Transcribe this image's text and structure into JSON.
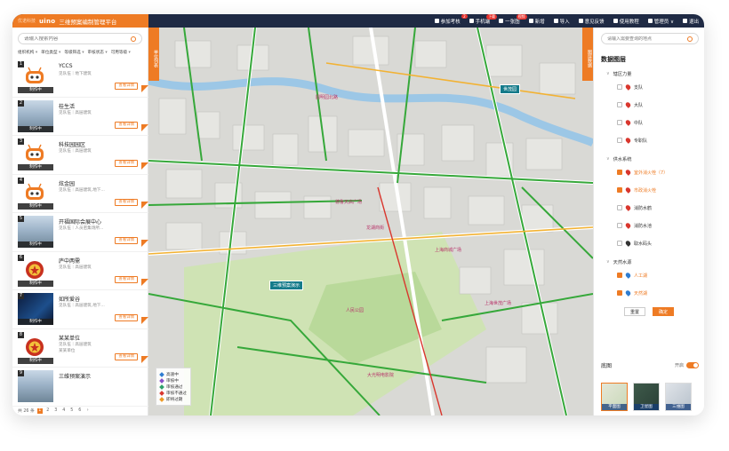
{
  "header": {
    "logo": "uino",
    "logo_sub": "优诺科技",
    "title": "三维预案编制管理平台",
    "menu": [
      {
        "label": "参加考核",
        "badge": "2",
        "icon": "document-icon"
      },
      {
        "label": "手机端",
        "badge": "下载",
        "icon": "phone-icon"
      },
      {
        "label": "一张图",
        "badge": "视频",
        "icon": "globe-icon"
      },
      {
        "label": "新增",
        "badge": "",
        "icon": "pencil-icon"
      },
      {
        "label": "导入",
        "badge": "",
        "icon": "arrow-up-icon"
      },
      {
        "label": "意见反馈",
        "badge": "",
        "icon": "info-icon"
      },
      {
        "label": "使用教程",
        "badge": "",
        "icon": "help-icon"
      },
      {
        "label": "管理员 ∨",
        "badge": "",
        "icon": "user-icon"
      },
      {
        "label": "退出",
        "badge": "",
        "icon": "logout-icon"
      }
    ]
  },
  "sidebar": {
    "search_placeholder": "请输入搜索内容",
    "filters": [
      "组织机构",
      "单位类型",
      "等级筛选",
      "审核状态",
      "可用等级"
    ],
    "collapse_label": "单位列表",
    "items": [
      {
        "num": "1",
        "name": "YCCS",
        "meta": "见队伍｜地下建筑",
        "sub": "",
        "status": "制作中",
        "button": "查看详情",
        "thumb": "robot"
      },
      {
        "num": "2",
        "name": "桂生活",
        "meta": "见队伍｜高层建筑",
        "sub": "",
        "status": "制作中",
        "button": "查看详情",
        "thumb": "photo"
      },
      {
        "num": "3",
        "name": "科技园园区",
        "meta": "见队伍｜高层建筑",
        "sub": "",
        "status": "制作中",
        "button": "查看详情",
        "thumb": "robot"
      },
      {
        "num": "4",
        "name": "炫金园",
        "meta": "见队伍｜高层建筑,地下...",
        "sub": "",
        "status": "制作中",
        "button": "查看详情",
        "thumb": "robot"
      },
      {
        "num": "5",
        "name": "开福国际会展中心",
        "meta": "见队伍｜人员密集场所...",
        "sub": "",
        "status": "制作中",
        "button": "查看详情",
        "thumb": "photo"
      },
      {
        "num": "6",
        "name": "庐中两需",
        "meta": "见队伍｜高层建筑",
        "sub": "",
        "status": "制作中",
        "button": "查看详情",
        "thumb": "emblem"
      },
      {
        "num": "7",
        "name": "如所爱谷",
        "meta": "见队伍｜高层建筑,地下...",
        "sub": "",
        "status": "制作中",
        "button": "查看详情",
        "thumb": "dark"
      },
      {
        "num": "8",
        "name": "某某单位",
        "meta": "见队伍｜高层建筑",
        "sub": "某某单位",
        "status": "制作中",
        "button": "查看详情",
        "thumb": "emblem"
      },
      {
        "num": "9",
        "name": "三维预案演示",
        "meta": "",
        "sub": "",
        "status": "",
        "button": "",
        "thumb": "photo"
      }
    ],
    "pager": {
      "prefix": "共 26 条",
      "pages": [
        "1",
        "2",
        "3",
        "4",
        "5",
        "6",
        "›"
      ]
    }
  },
  "map": {
    "labels": [
      {
        "text": "圆明园北路",
        "cls": "road"
      },
      {
        "text": "德鲁天启广场",
        "cls": "road"
      },
      {
        "text": "龙湖商街",
        "cls": "road"
      },
      {
        "text": "上海商城广场",
        "cls": "road"
      },
      {
        "text": "人民公园",
        "cls": "road"
      },
      {
        "text": "上海世茂广场",
        "cls": "road"
      },
      {
        "text": "大光明电影院",
        "cls": "road"
      }
    ],
    "tags": [
      "世茂园",
      "三维预案演示"
    ],
    "legend": [
      {
        "label": "高速中",
        "color": "#2f7dd1"
      },
      {
        "label": "审核中",
        "color": "#8a4fc9"
      },
      {
        "label": "审核通过",
        "color": "#2fa06a"
      },
      {
        "label": "审核不通过",
        "color": "#d9372e"
      },
      {
        "label": "即将过期",
        "color": "#ee9a24"
      }
    ],
    "right_collapse_label": "图层数据"
  },
  "right": {
    "search_placeholder": "请输入需要查询的地点",
    "title": "数据图层",
    "groups": [
      {
        "label": "辖区力量",
        "rows": [
          {
            "label": "支队",
            "checked": false,
            "pin": "#d9372e"
          },
          {
            "label": "大队",
            "checked": false,
            "pin": "#d9372e"
          },
          {
            "label": "中队",
            "checked": false,
            "pin": "#d9372e"
          },
          {
            "label": "专职队",
            "checked": false,
            "pin": "#d9372e"
          }
        ]
      },
      {
        "label": "供水系统",
        "rows": [
          {
            "label": "室外消火栓（7）",
            "checked": true,
            "pin": "#d9372e"
          },
          {
            "label": "市政消火栓",
            "checked": true,
            "pin": "#d9372e"
          },
          {
            "label": "消防水鹤",
            "checked": false,
            "pin": "#d9372e"
          },
          {
            "label": "消防水池",
            "checked": false,
            "pin": "#d9372e"
          },
          {
            "label": "取水码头",
            "checked": false,
            "pin": "#333333"
          }
        ]
      },
      {
        "label": "天然水源",
        "rows": [
          {
            "label": "人工湖",
            "checked": true,
            "pin": "#2f7dd1"
          },
          {
            "label": "天然湖",
            "checked": true,
            "pin": "#2f7dd1"
          }
        ]
      }
    ],
    "reset_label": "重置",
    "confirm_label": "确定",
    "basemap_title": "底图",
    "basemap_toggle_label": "开启",
    "basemaps": [
      {
        "label": "平面图",
        "active": true
      },
      {
        "label": "卫星图",
        "active": false
      },
      {
        "label": "三维图",
        "active": false
      }
    ]
  }
}
